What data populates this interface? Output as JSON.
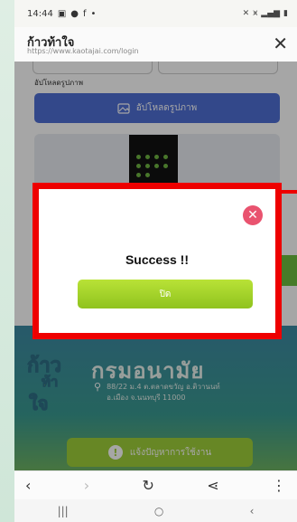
{
  "statusbar": {
    "time": "14:44",
    "notif_icons": [
      "image-icon",
      "message-icon",
      "facebook-icon",
      "dot-icon"
    ],
    "right_icons": [
      "mute-icon",
      "wifi-icon",
      "signal-icon",
      "battery-icon"
    ]
  },
  "titlebar": {
    "title": "ก้าวท้าใจ",
    "url": "https://www.kaotajai.com/login",
    "close_label": "✕"
  },
  "page": {
    "upload_label": "อัปโหลดรูปภาพ",
    "upload_button": "อัปโหลดรูปภาพ",
    "department": "กรมอนามัย",
    "address_line1": "88/22 ม.4 ต.ตลาดขวัญ อ.ติวานนท์",
    "address_line2": "อ.เมือง จ.นนทบุรี 11000",
    "report_button": "แจ้งปัญหาการใช้งาน",
    "logo_chars": [
      "ก้าว",
      "ท้า",
      "ใจ"
    ]
  },
  "modal": {
    "message": "Success !!",
    "confirm_label": "ปิด",
    "close_label": "✕"
  },
  "browser_nav": {
    "back": "‹",
    "forward": "›",
    "reload": "↻",
    "share": "⋖",
    "menu": "⋮"
  },
  "system_nav": {
    "recents": "|||",
    "home": "○",
    "back": "‹"
  },
  "colors": {
    "upload_blue": "#4f6fd4",
    "success_green": "#a6d22a",
    "highlight_red": "#ee0000",
    "close_pink": "#e9536f"
  }
}
